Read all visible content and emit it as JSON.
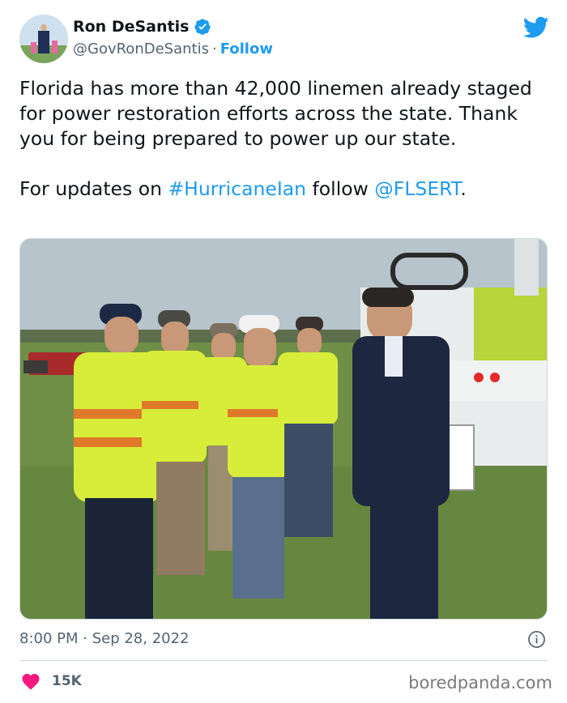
{
  "author": {
    "name": "Ron DeSantis",
    "handle": "@GovRonDeSantis",
    "separator": "·",
    "follow_label": "Follow",
    "avatar_icon": "profile-photo",
    "verified_icon": "verified-badge-icon",
    "brand_icon": "twitter-bird-icon"
  },
  "tweet": {
    "paragraph1": "Florida has more than 42,000 linemen already staged for power restoration efforts across the state. Thank you for being prepared to power up our state.",
    "paragraph2_prefix": "For updates on ",
    "hashtag": "#HurricaneIan",
    "paragraph2_middle": " follow ",
    "mention": "@FLSERT",
    "paragraph2_suffix": "."
  },
  "meta": {
    "timestamp": "8:00 PM · Sep 28, 2022",
    "info_icon": "info-icon"
  },
  "engagement": {
    "like_icon": "heart-icon",
    "like_count": "15K"
  },
  "watermark": "boredpanda.com",
  "colors": {
    "accent": "#1d9bf0",
    "text": "#0f1419",
    "secondary": "#536471",
    "like": "#f91880"
  }
}
